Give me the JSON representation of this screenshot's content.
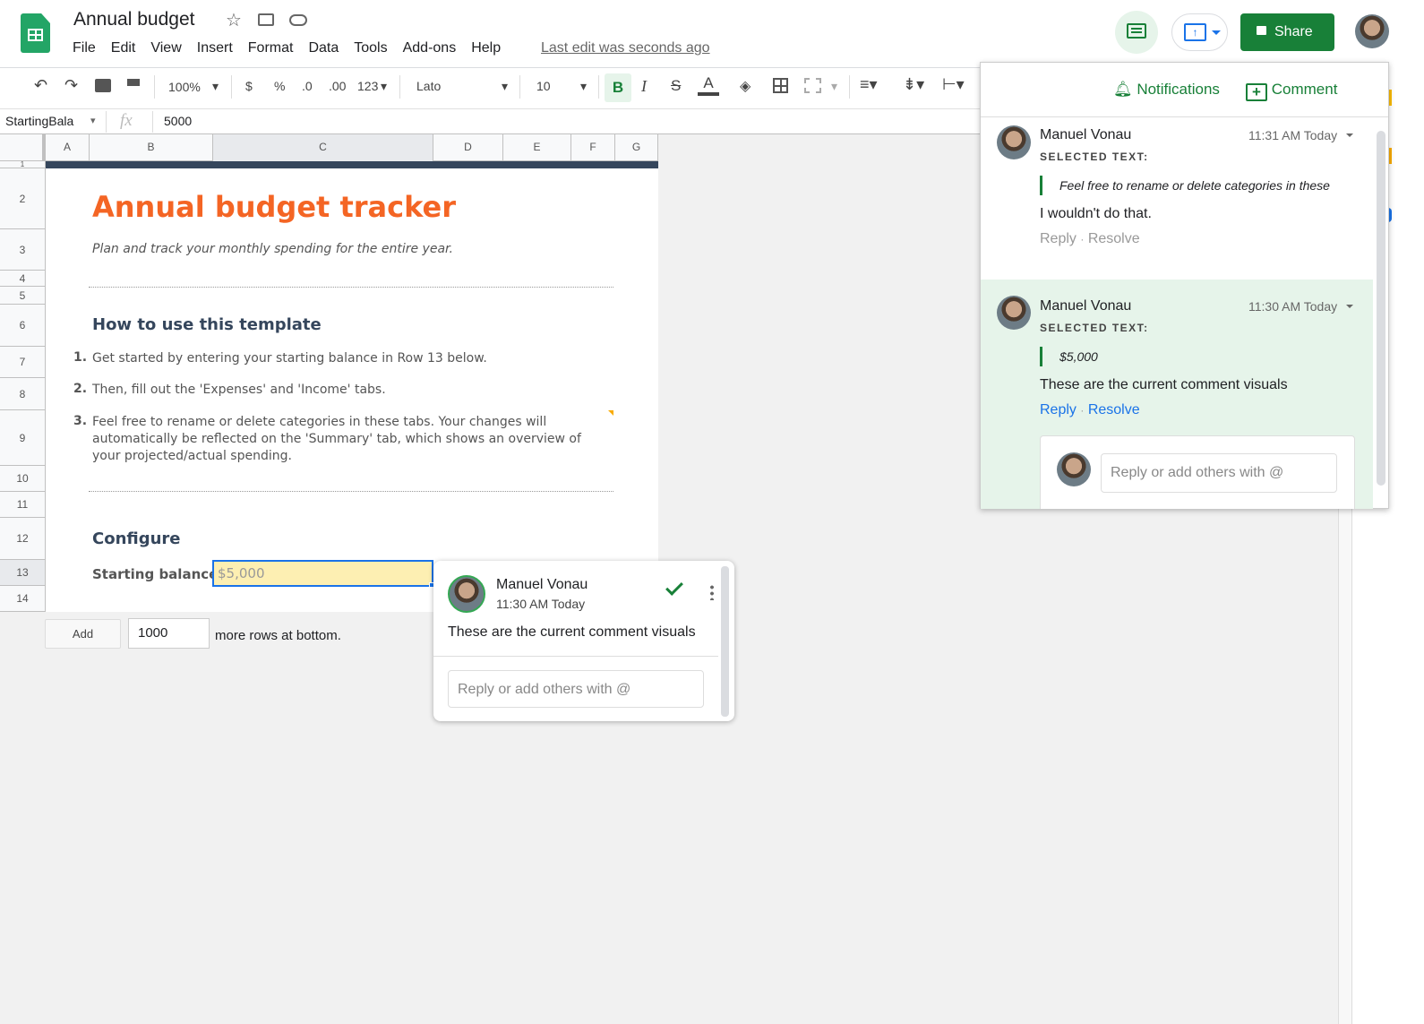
{
  "app": {
    "doc_title": "Annual budget",
    "last_edit": "Last edit was seconds ago"
  },
  "menu": [
    "File",
    "Edit",
    "View",
    "Insert",
    "Format",
    "Data",
    "Tools",
    "Add-ons",
    "Help"
  ],
  "header": {
    "share_label": "Share"
  },
  "toolbar": {
    "zoom": "100%",
    "currency": "$",
    "percent": "%",
    "dec_less": ".0",
    "dec_more": ".00",
    "format_more": "123",
    "font": "Lato",
    "font_size": "10",
    "bold": "B",
    "italic": "I",
    "strike": "S",
    "text_color": "A"
  },
  "formula": {
    "name_box": "StartingBala",
    "fx": "fx",
    "value": "5000"
  },
  "columns": [
    "A",
    "B",
    "C",
    "D",
    "E",
    "F",
    "G"
  ],
  "rows": [
    "1",
    "2",
    "3",
    "4",
    "5",
    "6",
    "7",
    "8",
    "9",
    "10",
    "11",
    "12",
    "13",
    "14"
  ],
  "sheet": {
    "title": "Annual budget tracker",
    "subtitle": "Plan and track your monthly spending for the entire year.",
    "howto_heading": "How to use this template",
    "steps": [
      {
        "n": "1.",
        "text": "Get started by entering your starting balance in Row 13 below."
      },
      {
        "n": "2.",
        "text": "Then, fill out the 'Expenses' and 'Income' tabs."
      },
      {
        "n": "3.",
        "text": "Feel free to rename or delete categories in these tabs. Your changes will automatically be reflected on the 'Summary' tab, which shows an overview of your projected/actual spending."
      }
    ],
    "configure_heading": "Configure",
    "starting_balance_label": "Starting balance:",
    "starting_balance_value": "$5,000"
  },
  "add_rows": {
    "button": "Add",
    "count": "1000",
    "suffix": "more rows at bottom."
  },
  "panel": {
    "notifications": "Notifications",
    "comment": "Comment",
    "threads": [
      {
        "author": "Manuel Vonau",
        "time": "11:31 AM Today",
        "selected_label": "SELECTED TEXT:",
        "quote": "Feel free to rename or delete categories in these",
        "text": "I wouldn't do that.",
        "reply": "Reply",
        "dot": "·",
        "resolve": "Resolve"
      },
      {
        "author": "Manuel Vonau",
        "time": "11:30 AM Today",
        "selected_label": "SELECTED TEXT:",
        "quote": "$5,000",
        "text": "These are the current comment visuals",
        "reply": "Reply",
        "dot": "·",
        "resolve": "Resolve",
        "reply_placeholder": "Reply or add others with @"
      }
    ]
  },
  "popup": {
    "author": "Manuel Vonau",
    "time": "11:30 AM Today",
    "text": "These are the current comment visuals",
    "reply_placeholder": "Reply or add others with @"
  }
}
